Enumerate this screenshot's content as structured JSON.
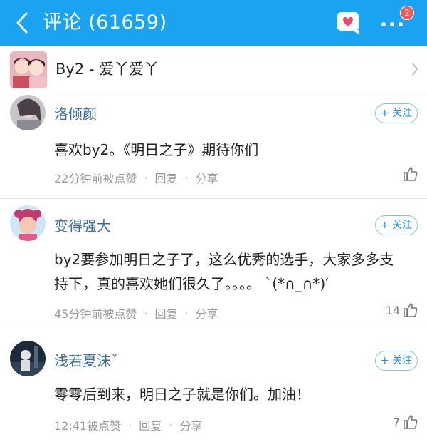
{
  "header": {
    "title": "评论 (61659)",
    "badge_count": "2",
    "bg_color": "#1aa3f0"
  },
  "topic": {
    "title": "By2 - 爱丫爱丫"
  },
  "comments": [
    {
      "username": "洛倾颜",
      "follow_label": "+ 关注",
      "text": "喜欢by2。《明日之子》期待你们",
      "time": "22分钟前被点赞",
      "reply": "回复",
      "share": "分享",
      "likes": ""
    },
    {
      "username": "变得强大",
      "follow_label": "+ 关注",
      "text": "by2要参加明日之子了，这么优秀的选手，大家多多支持下，真的喜欢她们很久了。。。。 `(*∩_∩*)′",
      "time": "45分钟前被点赞",
      "reply": "回复",
      "share": "分享",
      "likes": "14"
    },
    {
      "username": "浅若夏沫ˇ",
      "follow_label": "+ 关注",
      "text": "零零后到来，明日之子就是你们。加油！",
      "time": "12:41被点赞",
      "reply": "回复",
      "share": "分享",
      "likes": "7"
    }
  ]
}
